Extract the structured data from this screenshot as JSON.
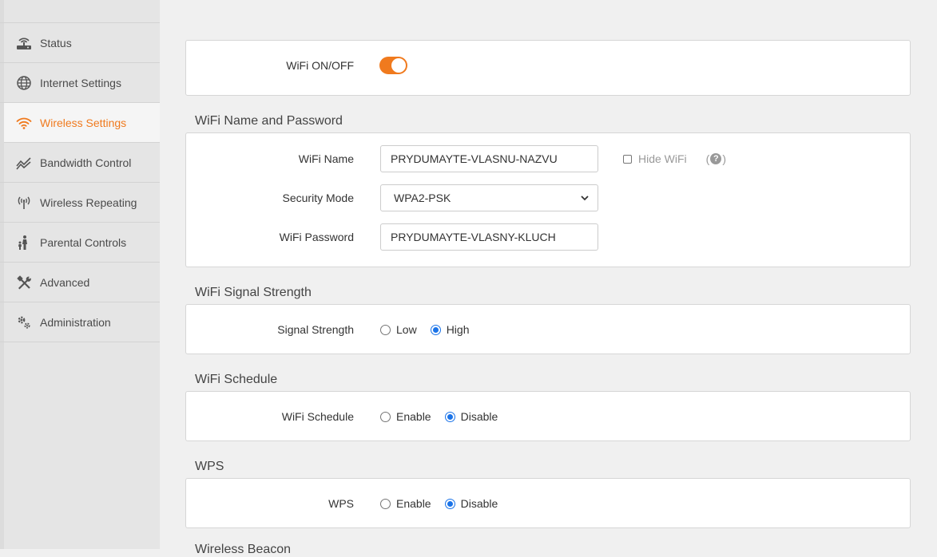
{
  "sidebar": {
    "items": [
      {
        "label": "Status",
        "icon": "router-icon",
        "active": false
      },
      {
        "label": "Internet Settings",
        "icon": "globe-icon",
        "active": false
      },
      {
        "label": "Wireless Settings",
        "icon": "wifi-icon",
        "active": true
      },
      {
        "label": "Bandwidth Control",
        "icon": "trend-icon",
        "active": false
      },
      {
        "label": "Wireless Repeating",
        "icon": "antenna-icon",
        "active": false
      },
      {
        "label": "Parental Controls",
        "icon": "family-icon",
        "active": false
      },
      {
        "label": "Advanced",
        "icon": "tools-icon",
        "active": false
      },
      {
        "label": "Administration",
        "icon": "gears-icon",
        "active": false
      }
    ]
  },
  "colors": {
    "accent": "#f07a1e",
    "radio_checked": "#1a73e8"
  },
  "wifi_toggle": {
    "label": "WiFi ON/OFF",
    "on": true
  },
  "name_password": {
    "title": "WiFi Name and Password",
    "wifi_name_label": "WiFi Name",
    "wifi_name_value": "PRYDUMAYTE-VLASNU-NAZVU",
    "hide_wifi_label": "Hide WiFi",
    "hide_wifi_checked": false,
    "help_open": "(",
    "help_symbol": "?",
    "help_close": ")",
    "security_mode_label": "Security Mode",
    "security_mode_value": "WPA2-PSK",
    "wifi_password_label": "WiFi Password",
    "wifi_password_value": "PRYDUMAYTE-VLASNY-KLUCH"
  },
  "signal": {
    "title": "WiFi Signal Strength",
    "label": "Signal Strength",
    "options": [
      "Low",
      "High"
    ],
    "selected": "High"
  },
  "schedule": {
    "title": "WiFi Schedule",
    "label": "WiFi Schedule",
    "options": [
      "Enable",
      "Disable"
    ],
    "selected": "Disable"
  },
  "wps": {
    "title": "WPS",
    "label": "WPS",
    "options": [
      "Enable",
      "Disable"
    ],
    "selected": "Disable"
  },
  "next_section": {
    "title": "Wireless Beacon"
  }
}
